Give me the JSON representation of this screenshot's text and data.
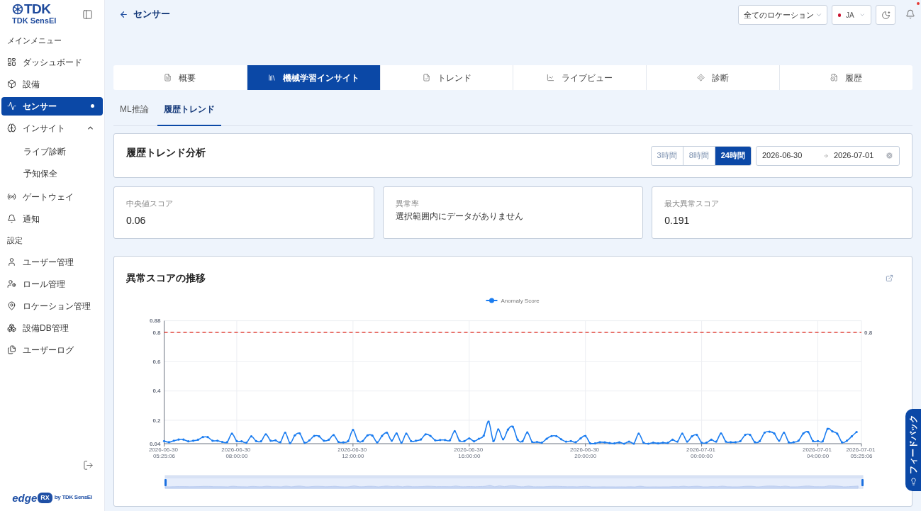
{
  "sidebar": {
    "logo": {
      "wordmark": "TDK",
      "product": "TDK SensEI"
    },
    "sections": [
      {
        "heading": "メインメニュー",
        "items": [
          {
            "label": "ダッシュボード",
            "selected": false
          },
          {
            "label": "設備",
            "selected": false
          },
          {
            "label": "センサー",
            "selected": true
          },
          {
            "label": "インサイト",
            "selected": false,
            "expanded": true,
            "children": [
              {
                "label": "ライブ診断",
                "selected": false
              },
              {
                "label": "予知保全",
                "selected": false
              }
            ]
          },
          {
            "label": "ゲートウェイ",
            "selected": false
          },
          {
            "label": "通知",
            "selected": false
          }
        ]
      },
      {
        "heading": "設定",
        "items": [
          {
            "label": "ユーザー管理",
            "selected": false
          },
          {
            "label": "ロール管理",
            "selected": false
          },
          {
            "label": "ロケーション管理",
            "selected": false
          },
          {
            "label": "設備DB管理",
            "selected": false
          },
          {
            "label": "ユーザーログ",
            "selected": false
          }
        ]
      }
    ],
    "footer_logo": {
      "wordmark": "edge",
      "mark": "RX",
      "byline": "by TDK SensEI"
    }
  },
  "header": {
    "title": "センサー",
    "location_select": "全てのロケーション",
    "language": "JA",
    "notifications_unread": true
  },
  "tabs": [
    {
      "label": "概要",
      "selected": false
    },
    {
      "label": "機械学習インサイト",
      "selected": true
    },
    {
      "label": "トレンド",
      "selected": false
    },
    {
      "label": "ライブビュー",
      "selected": false
    },
    {
      "label": "診断",
      "selected": false
    },
    {
      "label": "履歴",
      "selected": false
    }
  ],
  "subtabs": [
    {
      "label": "ML推論",
      "selected": false
    },
    {
      "label": "履歴トレンド",
      "selected": true
    }
  ],
  "trend_panel": {
    "title": "履歴トレンド分析",
    "ranges": [
      {
        "label": "3時間",
        "selected": false
      },
      {
        "label": "8時間",
        "selected": false
      },
      {
        "label": "24時間",
        "selected": true
      }
    ],
    "start_date": "2026-06-30",
    "end_date": "2026-07-01"
  },
  "stats": [
    {
      "kind": "value",
      "label": "中央値スコア",
      "value": "0.06"
    },
    {
      "kind": "message",
      "label": "異常率",
      "message": "選択範囲内にデータがありません"
    },
    {
      "kind": "value",
      "label": "最大異常スコア",
      "value": "0.191"
    }
  ],
  "chart_panel": {
    "chart_data": {
      "type": "line",
      "title": "異常スコアの推移",
      "grid": true,
      "categories": [
        "2026-06-30 05:25:06",
        null,
        null,
        null,
        null,
        null,
        null,
        null,
        null,
        null,
        null,
        null,
        null,
        null,
        null,
        "2026-06-30 08:00:00",
        null,
        null,
        null,
        null,
        null,
        null,
        null,
        null,
        null,
        null,
        null,
        null,
        null,
        null,
        null,
        null,
        null,
        null,
        null,
        null,
        null,
        null,
        null,
        "2026-06-30 12:00:00",
        null,
        null,
        null,
        null,
        null,
        null,
        null,
        null,
        null,
        null,
        null,
        null,
        null,
        null,
        null,
        null,
        null,
        null,
        null,
        null,
        null,
        null,
        null,
        "2026-06-30 16:00:00",
        null,
        null,
        null,
        null,
        null,
        null,
        null,
        null,
        null,
        null,
        null,
        null,
        null,
        null,
        null,
        null,
        null,
        null,
        null,
        null,
        null,
        null,
        null,
        "2026-06-30 20:00:00",
        null,
        null,
        null,
        null,
        null,
        null,
        null,
        null,
        null,
        null,
        null,
        null,
        null,
        null,
        null,
        null,
        null,
        null,
        null,
        null,
        null,
        null,
        null,
        "2026-07-01 00:00:00",
        null,
        null,
        null,
        null,
        null,
        null,
        null,
        null,
        null,
        null,
        null,
        null,
        null,
        null,
        null,
        null,
        null,
        null,
        null,
        null,
        null,
        null,
        null,
        "2026-07-01 04:00:00",
        null,
        null,
        null,
        null,
        null,
        null,
        null,
        null,
        "2026-07-01 05:25:06"
      ],
      "ylim": [
        0.04,
        0.88
      ],
      "yticks": [
        0.04,
        0.2,
        0.4,
        0.6,
        0.8,
        0.88
      ],
      "series": [
        {
          "name": "Anomaly Score",
          "color": "#1a7cf0",
          "values": [
            0.058,
            0.05,
            0.06,
            0.068,
            0.068,
            0.056,
            0.06,
            0.067,
            0.085,
            0.085,
            0.06,
            0.06,
            0.052,
            0.05,
            0.108,
            0.058,
            0.056,
            0.047,
            0.09,
            0.058,
            0.056,
            0.104,
            0.06,
            0.063,
            0.05,
            0.115,
            0.044,
            0.097,
            0.11,
            0.047,
            0.063,
            0.093,
            0.09,
            0.06,
            0.067,
            0.099,
            0.052,
            0.049,
            0.058,
            0.134,
            0.058,
            0.058,
            0.097,
            0.095,
            0.049,
            0.093,
            0.115,
            0.06,
            0.11,
            0.047,
            0.108,
            0.058,
            0.06,
            0.068,
            0.104,
            0.093,
            0.063,
            0.065,
            0.065,
            0.063,
            0.125,
            0.06,
            0.058,
            0.076,
            0.056,
            0.074,
            0.095,
            0.191,
            0.058,
            0.138,
            0.07,
            0.136,
            0.156,
            0.067,
            0.056,
            0.117,
            0.052,
            0.052,
            0.047,
            0.074,
            0.092,
            0.092,
            0.07,
            0.054,
            0.058,
            0.05,
            0.076,
            0.093,
            0.042,
            0.042,
            0.05,
            0.049,
            0.044,
            0.042,
            0.049,
            0.04,
            0.054,
            0.04,
            0.108,
            0.047,
            0.04,
            0.047,
            0.042,
            0.047,
            0.045,
            0.067,
            0.054,
            0.108,
            0.054,
            0.09,
            0.1,
            0.047,
            0.047,
            0.067,
            0.054,
            0.11,
            0.054,
            0.05,
            0.05,
            0.058,
            0.1,
            0.1,
            0.05,
            0.058,
            0.115,
            0.122,
            0.11,
            0.06,
            0.115,
            0.049,
            0.05,
            0.06,
            0.11,
            0.12,
            0.058,
            0.058,
            0.056,
            0.141,
            0.124,
            0.108,
            0.049,
            0.06,
            0.09,
            0.12,
            null
          ]
        }
      ],
      "ref_lines": [
        {
          "axis": "y",
          "value": 0.8,
          "label": "0.8",
          "color": "#e5483f"
        }
      ]
    }
  },
  "feedback_tab": {
    "label": "フィードバック"
  }
}
